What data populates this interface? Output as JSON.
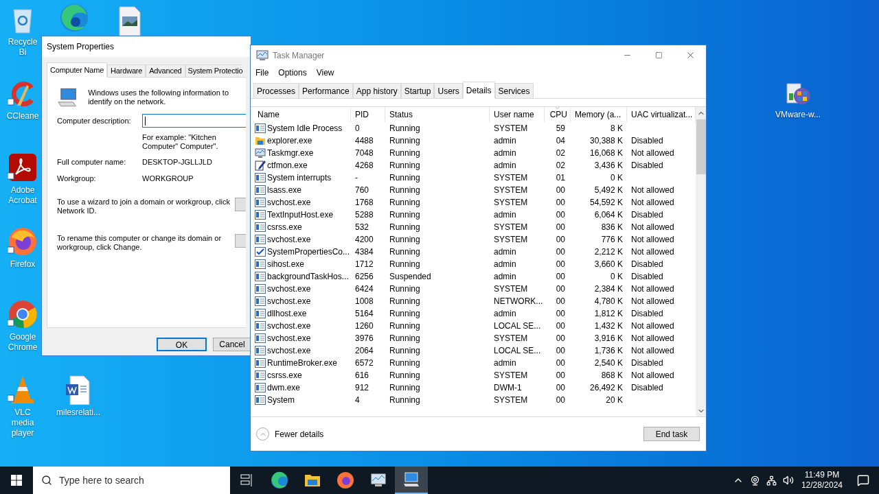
{
  "desktop_icons": [
    {
      "kind": "recycle",
      "label": "Recycle Bi"
    },
    {
      "kind": "edge"
    },
    {
      "kind": "image"
    },
    {
      "kind": "ccleaner",
      "label": "CCleane"
    },
    {
      "kind": "acrobat",
      "label": "Adobe Acrobat"
    },
    {
      "kind": "firefox",
      "label": "Firefox"
    },
    {
      "kind": "chrome",
      "label": "Google Chrome"
    },
    {
      "kind": "vlc",
      "label": "VLC media player"
    },
    {
      "kind": "word",
      "label": "milesrelati..."
    },
    {
      "kind": "installer",
      "label": "VMware-w..."
    }
  ],
  "system_properties": {
    "title": "System Properties",
    "tabs": [
      {
        "label": "Computer Name",
        "selected": true
      },
      {
        "label": "Hardware",
        "selected": false
      },
      {
        "label": "Advanced",
        "selected": false
      },
      {
        "label": "System Protectio",
        "selected": false
      }
    ],
    "intro": "Windows uses the following information to identify on the network.",
    "description_label": "Computer description:",
    "example": "For example: \"Kitchen Computer\" Computer\".",
    "full_name_label": "Full computer name:",
    "full_name": "DESKTOP-JGLLJLD",
    "workgroup_label": "Workgroup:",
    "workgroup": "WORKGROUP",
    "network_id_text": "To use a wizard to join a domain or workgroup, click Network ID.",
    "rename_text": "To rename this computer or change its domain or workgroup, click Change.",
    "buttons": [
      "OK",
      "Cancel"
    ]
  },
  "task_manager": {
    "title": "Task Manager",
    "menu": [
      "File",
      "Options",
      "View"
    ],
    "tabs": [
      {
        "label": "Processes",
        "selected": false
      },
      {
        "label": "Performance",
        "selected": false
      },
      {
        "label": "App history",
        "selected": false
      },
      {
        "label": "Startup",
        "selected": false
      },
      {
        "label": "Users",
        "selected": false
      },
      {
        "label": "Details",
        "selected": true
      },
      {
        "label": "Services",
        "selected": false
      }
    ],
    "columns": [
      {
        "label": "Name",
        "sorted": false
      },
      {
        "label": "PID",
        "sorted": false
      },
      {
        "label": "Status",
        "sorted": false
      },
      {
        "label": "User name",
        "sorted": false
      },
      {
        "label": "CPU",
        "sorted": true
      },
      {
        "label": "Memory (a...",
        "sorted": false
      },
      {
        "label": "UAC virtualizat...",
        "sorted": false
      }
    ],
    "rows": [
      {
        "kind": "service",
        "name": "System Idle Process",
        "pid": "0",
        "status": "Running",
        "user": "SYSTEM",
        "cpu": "59",
        "memory": "8 K"
      },
      {
        "kind": "folder",
        "name": "explorer.exe",
        "pid": "4488",
        "status": "Running",
        "user": "admin",
        "cpu": "04",
        "memory": "30,388 K",
        "uac": "Disabled"
      },
      {
        "kind": "monitor",
        "name": "Taskmgr.exe",
        "pid": "7048",
        "status": "Running",
        "user": "admin",
        "cpu": "02",
        "memory": "16,068 K",
        "uac": "Not allowed"
      },
      {
        "kind": "pen",
        "name": "ctfmon.exe",
        "pid": "4268",
        "status": "Running",
        "user": "admin",
        "cpu": "02",
        "memory": "3,436 K",
        "uac": "Disabled"
      },
      {
        "kind": "service",
        "name": "System interrupts",
        "pid": "-",
        "status": "Running",
        "user": "SYSTEM",
        "cpu": "01",
        "memory": "0 K"
      },
      {
        "kind": "service",
        "name": "lsass.exe",
        "pid": "760",
        "status": "Running",
        "user": "SYSTEM",
        "cpu": "00",
        "memory": "5,492 K",
        "uac": "Not allowed"
      },
      {
        "kind": "service",
        "name": "svchost.exe",
        "pid": "1768",
        "status": "Running",
        "user": "SYSTEM",
        "cpu": "00",
        "memory": "54,592 K",
        "uac": "Not allowed"
      },
      {
        "kind": "service",
        "name": "TextInputHost.exe",
        "pid": "5288",
        "status": "Running",
        "user": "admin",
        "cpu": "00",
        "memory": "6,064 K",
        "uac": "Disabled"
      },
      {
        "kind": "service",
        "name": "csrss.exe",
        "pid": "532",
        "status": "Running",
        "user": "SYSTEM",
        "cpu": "00",
        "memory": "836 K",
        "uac": "Not allowed"
      },
      {
        "kind": "service",
        "name": "svchost.exe",
        "pid": "4200",
        "status": "Running",
        "user": "SYSTEM",
        "cpu": "00",
        "memory": "776 K",
        "uac": "Not allowed"
      },
      {
        "kind": "check",
        "name": "SystemPropertiesCo...",
        "pid": "4384",
        "status": "Running",
        "user": "admin",
        "cpu": "00",
        "memory": "2,212 K",
        "uac": "Not allowed"
      },
      {
        "kind": "service",
        "name": "sihost.exe",
        "pid": "1712",
        "status": "Running",
        "user": "admin",
        "cpu": "00",
        "memory": "3,660 K",
        "uac": "Disabled"
      },
      {
        "kind": "service",
        "name": "backgroundTaskHos...",
        "pid": "6256",
        "status": "Suspended",
        "user": "admin",
        "cpu": "00",
        "memory": "0 K",
        "uac": "Disabled"
      },
      {
        "kind": "service",
        "name": "svchost.exe",
        "pid": "6424",
        "status": "Running",
        "user": "SYSTEM",
        "cpu": "00",
        "memory": "2,384 K",
        "uac": "Not allowed"
      },
      {
        "kind": "service",
        "name": "svchost.exe",
        "pid": "1008",
        "status": "Running",
        "user": "NETWORK...",
        "cpu": "00",
        "memory": "4,780 K",
        "uac": "Not allowed"
      },
      {
        "kind": "service",
        "name": "dllhost.exe",
        "pid": "5164",
        "status": "Running",
        "user": "admin",
        "cpu": "00",
        "memory": "1,812 K",
        "uac": "Disabled"
      },
      {
        "kind": "service",
        "name": "svchost.exe",
        "pid": "1260",
        "status": "Running",
        "user": "LOCAL SE...",
        "cpu": "00",
        "memory": "1,432 K",
        "uac": "Not allowed"
      },
      {
        "kind": "service",
        "name": "svchost.exe",
        "pid": "3976",
        "status": "Running",
        "user": "SYSTEM",
        "cpu": "00",
        "memory": "3,916 K",
        "uac": "Not allowed"
      },
      {
        "kind": "service",
        "name": "svchost.exe",
        "pid": "2064",
        "status": "Running",
        "user": "LOCAL SE...",
        "cpu": "00",
        "memory": "1,736 K",
        "uac": "Not allowed"
      },
      {
        "kind": "service",
        "name": "RuntimeBroker.exe",
        "pid": "6572",
        "status": "Running",
        "user": "admin",
        "cpu": "00",
        "memory": "2,540 K",
        "uac": "Disabled"
      },
      {
        "kind": "service",
        "name": "csrss.exe",
        "pid": "616",
        "status": "Running",
        "user": "SYSTEM",
        "cpu": "00",
        "memory": "868 K",
        "uac": "Not allowed"
      },
      {
        "kind": "service",
        "name": "dwm.exe",
        "pid": "912",
        "status": "Running",
        "user": "DWM-1",
        "cpu": "00",
        "memory": "26,492 K",
        "uac": "Disabled"
      },
      {
        "kind": "service",
        "name": "System",
        "pid": "4",
        "status": "Running",
        "user": "SYSTEM",
        "cpu": "00",
        "memory": "20 K"
      }
    ],
    "fewer_details": "Fewer details",
    "end_task": "End task"
  },
  "taskbar": {
    "search_placeholder": "Type here to search",
    "apps": [
      {
        "kind": "taskview",
        "active": false
      },
      {
        "kind": "edge",
        "active": false
      },
      {
        "kind": "explorer",
        "active": false
      },
      {
        "kind": "firefox",
        "active": false
      },
      {
        "kind": "taskmgr",
        "active": false
      },
      {
        "kind": "sysprops",
        "active": true
      }
    ],
    "time": "11:49 PM",
    "date": "12/28/2024"
  }
}
